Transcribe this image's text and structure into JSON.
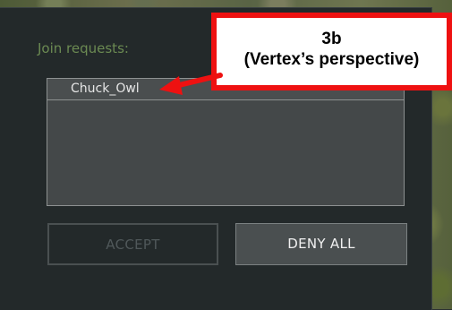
{
  "dialog": {
    "join_label": "Join requests:",
    "requests": [
      {
        "name": "Chuck_Owl"
      }
    ],
    "buttons": {
      "accept_label": "ACCEPT",
      "deny_all_label": "DENY ALL"
    }
  },
  "annotation": {
    "line1": "3b",
    "line2": "(Vertex’s perspective)",
    "border_color": "#ee1111"
  },
  "colors": {
    "panel_bg": "#23292a",
    "label_green": "#6b8a52",
    "list_bg": "#444849",
    "deny_bg": "#4a4f50"
  }
}
